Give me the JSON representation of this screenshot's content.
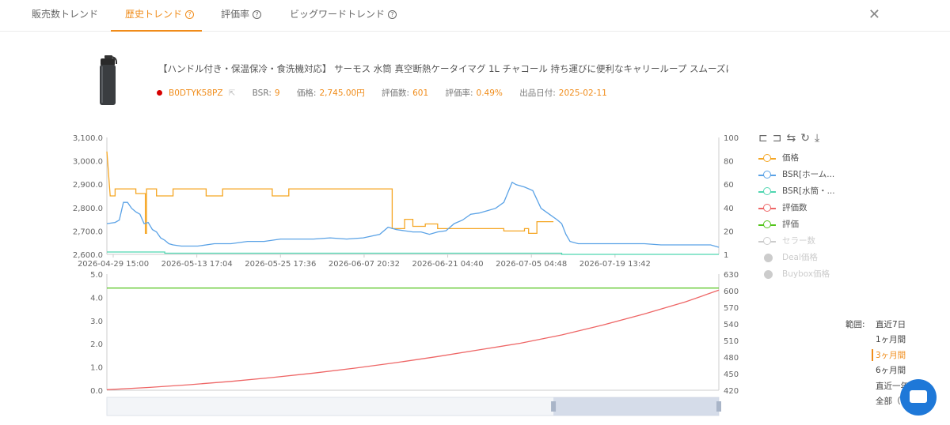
{
  "tabs": [
    {
      "label": "販売数トレンド",
      "help": false
    },
    {
      "label": "歴史トレンド",
      "help": true,
      "active": true
    },
    {
      "label": "評価率",
      "help": true
    },
    {
      "label": "ビッグワードトレンド",
      "help": true
    }
  ],
  "product": {
    "title": "【ハンドル付き・保温保冷・食洗機対応】 サーモス 水筒 真空断熱ケータイマグ 1L チャコール 持ち運びに便利なキャリーループ スムーズに飲め...",
    "asin": "B0DTYK58PZ",
    "bsr_label": "BSR:",
    "bsr": "9",
    "price_label": "価格:",
    "price": "2,745.00円",
    "reviews_label": "評価数:",
    "reviews": "601",
    "rate_label": "評価率:",
    "rate": "0.49%",
    "date_label": "出品日付:",
    "date": "2025-02-11"
  },
  "colors": {
    "accent": "#f08c1a",
    "price": "#f5a623",
    "bsr_home": "#5aa2e6",
    "bsr_bottle": "#4fd6b0",
    "reviews": "#ee6666",
    "rating": "#52c41a"
  },
  "legend": [
    {
      "label": "価格",
      "color": "#f5a623",
      "active": true
    },
    {
      "label": "BSR[ホーム...",
      "color": "#5aa2e6",
      "active": true
    },
    {
      "label": "BSR[水筒・...",
      "color": "#4fd6b0",
      "active": true
    },
    {
      "label": "評価数",
      "color": "#ee6666",
      "active": true
    },
    {
      "label": "評価",
      "color": "#52c41a",
      "active": true
    },
    {
      "label": "セラー数",
      "color": "#cccccc",
      "active": false,
      "style": "circle"
    },
    {
      "label": "Deal価格",
      "color": "#cccccc",
      "active": false,
      "style": "filled"
    },
    {
      "label": "Buybox価格",
      "color": "#cccccc",
      "active": false,
      "style": "filled"
    }
  ],
  "toolbar": [
    "crop-icon",
    "crop-reset-icon",
    "swap-icon",
    "refresh-icon",
    "download-icon"
  ],
  "range": {
    "label": "範囲:",
    "options": [
      "直近7日",
      "1ヶ月間",
      "3ヶ月間",
      "6ヶ月間",
      "直近一年",
      "全部（"
    ],
    "selected": "3ヶ月間"
  },
  "chart_data": [
    {
      "type": "line",
      "title": "",
      "x_ticks": [
        "2026-04-29 15:00",
        "2026-05-13 17:04",
        "2026-05-25 17:36",
        "2026-06-07 20:32",
        "2026-06-21 04:40",
        "2026-07-05 04:48",
        "2026-07-19 13:42"
      ],
      "y_left_ticks": [
        "3,100.0",
        "3,000.0",
        "2,900.0",
        "2,800.0",
        "2,700.0",
        "2,600.0"
      ],
      "y_left_range": [
        2600,
        3100
      ],
      "y_right_ticks": [
        "100",
        "80",
        "60",
        "40",
        "20",
        "1"
      ],
      "y_right_range": [
        1,
        100
      ],
      "x_range": [
        0,
        90
      ],
      "series": [
        {
          "name": "価格",
          "axis": "left",
          "points": [
            [
              0,
              3040
            ],
            [
              0.8,
              2850
            ],
            [
              2,
              2850
            ],
            [
              2,
              2880
            ],
            [
              7,
              2880
            ],
            [
              7,
              2860
            ],
            [
              9.3,
              2860
            ],
            [
              9.3,
              2690
            ],
            [
              9.6,
              2690
            ],
            [
              9.6,
              2880
            ],
            [
              12,
              2880
            ],
            [
              12,
              2850
            ],
            [
              16,
              2850
            ],
            [
              16,
              2880
            ],
            [
              24,
              2880
            ],
            [
              24,
              2850
            ],
            [
              28,
              2850
            ],
            [
              28,
              2880
            ],
            [
              40,
              2880
            ],
            [
              40,
              2850
            ],
            [
              44,
              2850
            ],
            [
              44,
              2880
            ],
            [
              69,
              2880
            ],
            [
              69,
              2710
            ],
            [
              72,
              2710
            ],
            [
              72,
              2750
            ],
            [
              74,
              2750
            ],
            [
              74,
              2720
            ],
            [
              77,
              2720
            ],
            [
              77,
              2730
            ],
            [
              80,
              2730
            ],
            [
              80,
              2710
            ],
            [
              96,
              2710
            ],
            [
              96,
              2700
            ],
            [
              101,
              2700
            ],
            [
              101,
              2710
            ],
            [
              102,
              2710
            ],
            [
              102,
              2690
            ],
            [
              104,
              2690
            ],
            [
              104,
              2740
            ],
            [
              108,
              2740
            ]
          ]
        },
        {
          "name": "BSR[ホーム...",
          "axis": "right",
          "points": [
            [
              0,
              27
            ],
            [
              2,
              28
            ],
            [
              3,
              30
            ],
            [
              4,
              45
            ],
            [
              5,
              45
            ],
            [
              6,
              40
            ],
            [
              7,
              37
            ],
            [
              8,
              35
            ],
            [
              9,
              27
            ],
            [
              10,
              28
            ],
            [
              11,
              22
            ],
            [
              12,
              20
            ],
            [
              13,
              15
            ],
            [
              14,
              13
            ],
            [
              15,
              10
            ],
            [
              16,
              9
            ],
            [
              18,
              8
            ],
            [
              22,
              8
            ],
            [
              26,
              10
            ],
            [
              30,
              10
            ],
            [
              34,
              12
            ],
            [
              38,
              12
            ],
            [
              42,
              14
            ],
            [
              46,
              14
            ],
            [
              50,
              14
            ],
            [
              54,
              15
            ],
            [
              58,
              14
            ],
            [
              62,
              15
            ],
            [
              66,
              18
            ],
            [
              68,
              24
            ],
            [
              70,
              22
            ],
            [
              72,
              21
            ],
            [
              74,
              20
            ],
            [
              76,
              20
            ],
            [
              78,
              18
            ],
            [
              80,
              20
            ],
            [
              82,
              21
            ],
            [
              84,
              27
            ],
            [
              86,
              30
            ],
            [
              88,
              35
            ],
            [
              90,
              36
            ],
            [
              92,
              38
            ],
            [
              94,
              40
            ],
            [
              96,
              45
            ],
            [
              98,
              62
            ],
            [
              99,
              60
            ],
            [
              101,
              58
            ],
            [
              103,
              55
            ],
            [
              105,
              40
            ],
            [
              107,
              35
            ],
            [
              109,
              30
            ],
            [
              110,
              27
            ],
            [
              111,
              18
            ],
            [
              112,
              12
            ],
            [
              114,
              10
            ],
            [
              118,
              10
            ],
            [
              122,
              10
            ],
            [
              126,
              10
            ],
            [
              130,
              10
            ],
            [
              134,
              9
            ],
            [
              138,
              9
            ],
            [
              142,
              9
            ],
            [
              146,
              9
            ],
            [
              148,
              7
            ]
          ]
        },
        {
          "name": "BSR[水筒・...",
          "axis": "right",
          "points": [
            [
              0,
              3
            ],
            [
              14,
              3
            ],
            [
              14,
              2
            ],
            [
              110,
              2
            ],
            [
              110,
              1
            ],
            [
              148,
              1
            ]
          ]
        }
      ]
    },
    {
      "type": "line",
      "title": "",
      "y_left_ticks": [
        "5.0",
        "4.0",
        "3.0",
        "2.0",
        "1.0",
        "0.0"
      ],
      "y_left_range": [
        0,
        5
      ],
      "y_right_ticks": [
        "630",
        "600",
        "570",
        "540",
        "510",
        "480",
        "450",
        "420"
      ],
      "y_right_range": [
        420,
        630
      ],
      "series": [
        {
          "name": "評価",
          "axis": "left",
          "points": [
            [
              0,
              4.4
            ],
            [
              148,
              4.4
            ]
          ]
        },
        {
          "name": "評価数",
          "axis": "right",
          "points": [
            [
              0,
              421
            ],
            [
              10,
              425
            ],
            [
              20,
              430
            ],
            [
              30,
              436
            ],
            [
              40,
              443
            ],
            [
              50,
              451
            ],
            [
              60,
              460
            ],
            [
              70,
              470
            ],
            [
              80,
              481
            ],
            [
              90,
              493
            ],
            [
              100,
              505
            ],
            [
              110,
              520
            ],
            [
              120,
              538
            ],
            [
              130,
              558
            ],
            [
              140,
              580
            ],
            [
              148,
              601
            ]
          ]
        }
      ]
    }
  ]
}
